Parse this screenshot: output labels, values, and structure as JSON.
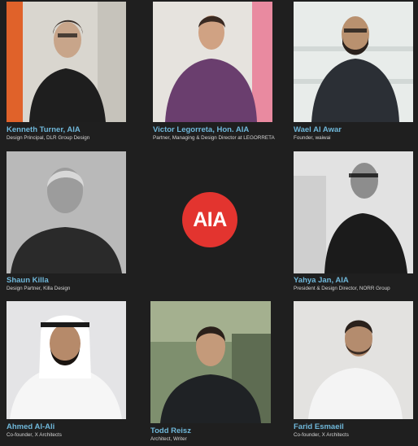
{
  "logo": {
    "text": "AIA",
    "color": "#e3342f"
  },
  "people": [
    {
      "name": "Kenneth Turner, AIA",
      "role": "Design Principal, DLR Group Design"
    },
    {
      "name": "Victor Legorreta, Hon. AIA",
      "role": "Partner, Managing & Design Director at LEGORRETA"
    },
    {
      "name": "Wael Al Awar",
      "role": "Founder, waiwai"
    },
    {
      "name": "Shaun Killa",
      "role": "Design Partner, Killa Design"
    },
    {
      "name": "Yahya Jan, AIA",
      "role": "President & Design Director, NORR Group"
    },
    {
      "name": "Ahmed Al-Ali",
      "role": "Co-founder, X Architects"
    },
    {
      "name": "Todd Reisz",
      "role": "Architect, Writer"
    },
    {
      "name": "Farid Esmaeil",
      "role": "Co-founder, X Architects"
    }
  ]
}
